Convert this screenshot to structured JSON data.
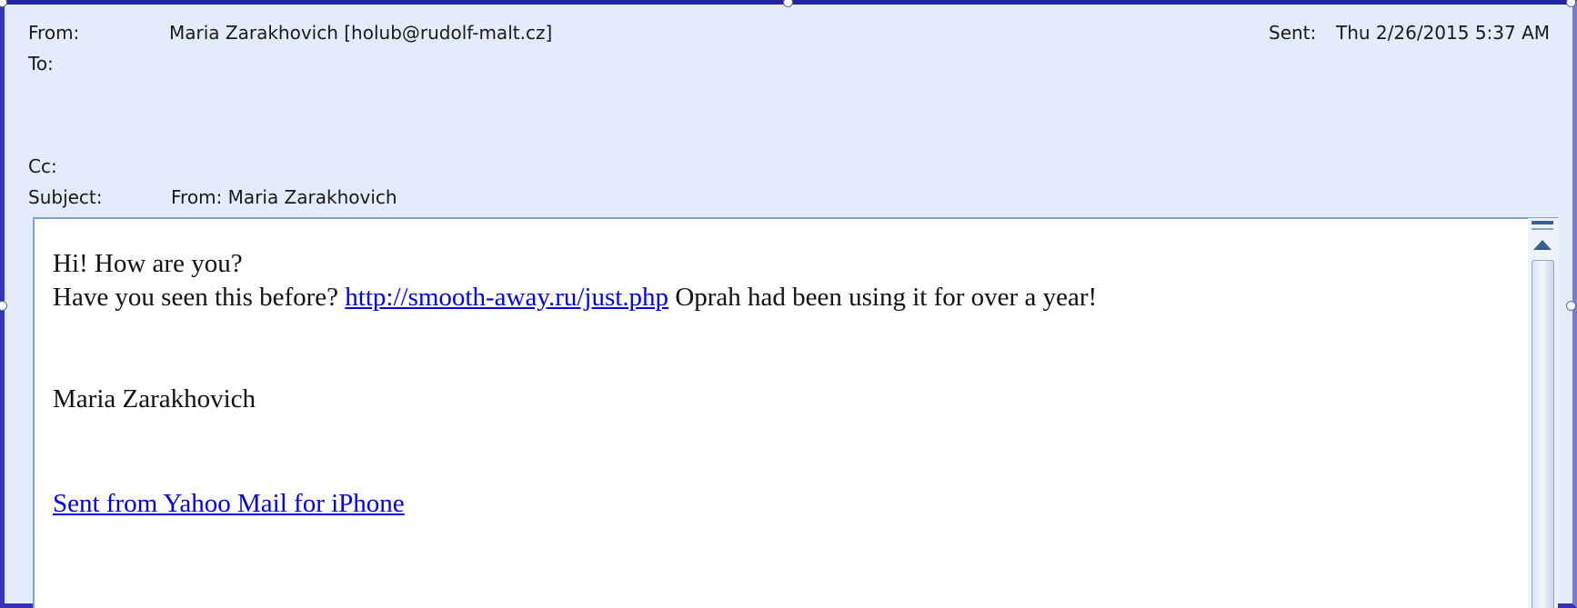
{
  "header": {
    "from_label": "From:",
    "from_value": "Maria Zarakhovich [holub@rudolf-malt.cz]",
    "to_label": "To:",
    "cc_label": "Cc:",
    "subject_label": "Subject:",
    "subject_value": "From:  Maria Zarakhovich",
    "sent_label": "Sent:",
    "sent_value": "Thu 2/26/2015 5:37 AM"
  },
  "message": {
    "line1": "Hi! How are you?",
    "line2_before": "Have you seen this before? ",
    "line2_link": "http://smooth-away.ru/just.php",
    "line2_after": " Oprah had been using it for over a year!",
    "signature": "Maria Zarakhovich",
    "footer_link": "Sent from Yahoo Mail for iPhone"
  },
  "colors": {
    "header_background": "#e3ecfa",
    "link": "#0000ee",
    "frame": "#2323a6"
  }
}
